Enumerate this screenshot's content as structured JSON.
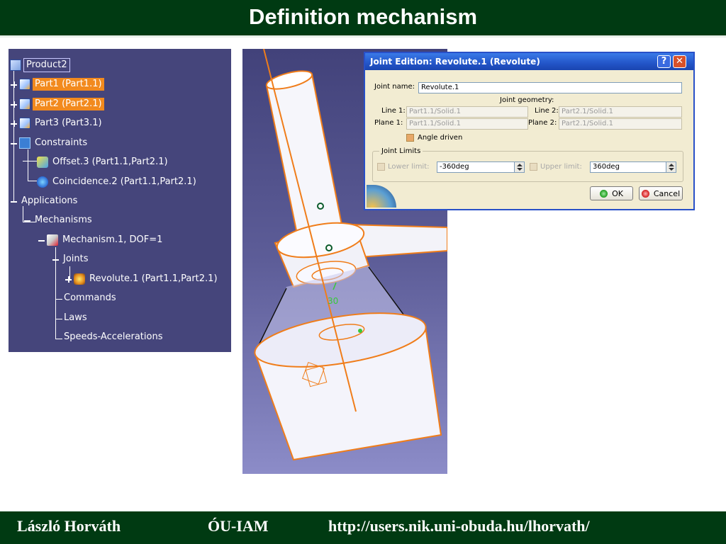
{
  "slide": {
    "title": "Definition mechanism"
  },
  "footer": {
    "author": "László Horváth",
    "org": "ÓU-IAM",
    "url": "http://users.nik.uni-obuda.hu/lhorvath/"
  },
  "tree": {
    "root": "Product2",
    "part1": "Part1 (Part1.1)",
    "part2": "Part2 (Part2.1)",
    "part3": "Part3 (Part3.1)",
    "constraints": "Constraints",
    "offset": "Offset.3 (Part1.1,Part2.1)",
    "coincidence": "Coincidence.2 (Part1.1,Part2.1)",
    "applications": "Applications",
    "mechanisms": "Mechanisms",
    "mechanism": "Mechanism.1, DOF=1",
    "joints": "Joints",
    "revolute": "Revolute.1 (Part1.1,Part2.1)",
    "commands": "Commands",
    "laws": "Laws",
    "speeds": "Speeds-Accelerations"
  },
  "viewer": {
    "angle_label": "30"
  },
  "dialog": {
    "title": "Joint Edition: Revolute.1 (Revolute)",
    "help_glyph": "?",
    "close_glyph": "✕",
    "joint_name_label": "Joint name:",
    "joint_name_value": "Revolute.1",
    "joint_geometry_label": "Joint geometry:",
    "line1_label": "Line 1:",
    "line1_value": "Part1.1/Solid.1",
    "line2_label": "Line 2:",
    "line2_value": "Part2.1/Solid.1",
    "plane1_label": "Plane 1:",
    "plane1_value": "Part1.1/Solid.1",
    "plane2_label": "Plane 2:",
    "plane2_value": "Part2.1/Solid.1",
    "angle_driven_label": "Angle driven",
    "angle_driven_checked": true,
    "joint_limits_label": "Joint Limits",
    "lower_limit_label": "Lower limit:",
    "lower_limit_value": "-360deg",
    "upper_limit_label": "Upper limit:",
    "upper_limit_value": "360deg",
    "ok_label": "OK",
    "cancel_label": "Cancel"
  },
  "colors": {
    "title_bar": "#003a12",
    "tree_bg": "#45457b",
    "highlight": "#f28a1e",
    "dialog_bg": "#f2ecd2",
    "dialog_title": "#2355c8",
    "model_edge": "#f07d1a"
  }
}
